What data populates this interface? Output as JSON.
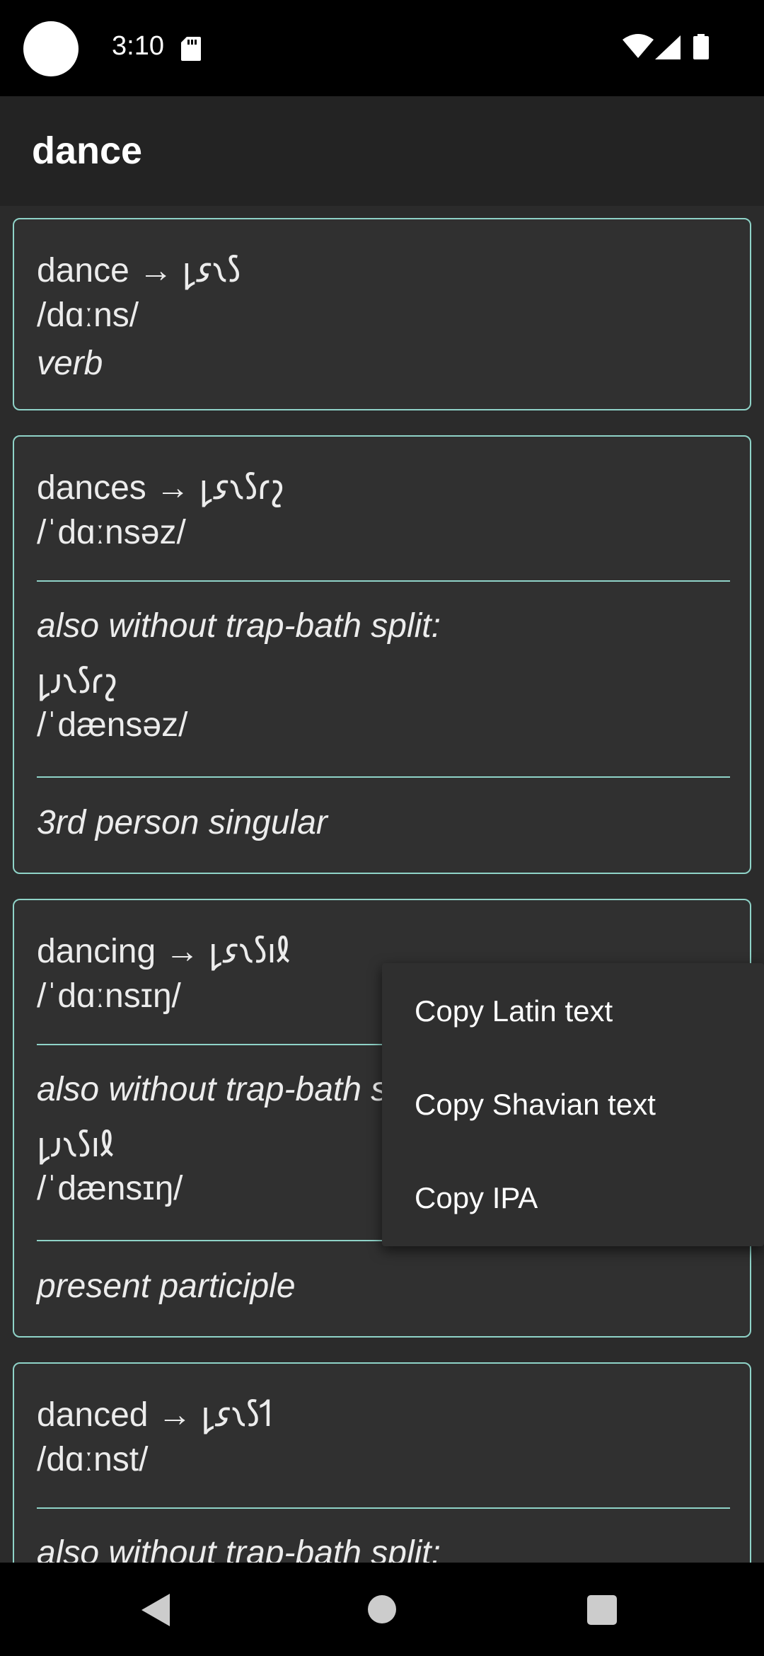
{
  "status": {
    "time": "3:10"
  },
  "app_bar": {
    "title": "dance"
  },
  "cards": [
    {
      "headword": "dance → 𐑛𐑭𐑯𐑕",
      "ipa": "/dɑːns/",
      "pos": "verb"
    },
    {
      "headword": "dances → 𐑛𐑭𐑯𐑕𐑩𐑟",
      "ipa": "/ˈdɑːnsəz/",
      "alt_label": "also without trap-bath split:",
      "alt_shavian": "𐑛𐑨𐑯𐑕𐑩𐑟",
      "alt_ipa": "/ˈdænsəz/",
      "form": "3rd person singular"
    },
    {
      "headword": "dancing → 𐑛𐑭𐑯𐑕𐑦𐑙",
      "ipa": "/ˈdɑːnsɪŋ/",
      "alt_label": "also without trap-bath split:",
      "alt_shavian": "𐑛𐑨𐑯𐑕𐑦𐑙",
      "alt_ipa": "/ˈdænsɪŋ/",
      "form": "present participle"
    },
    {
      "headword": "danced → 𐑛𐑭𐑯𐑕𐑑",
      "ipa": "/dɑːnst/",
      "alt_label": "also without trap-bath split:"
    }
  ],
  "menu": {
    "items": [
      "Copy Latin text",
      "Copy Shavian text",
      "Copy IPA"
    ]
  },
  "colors": {
    "accent_border": "#8fd3c8",
    "background": "#2b2b2b",
    "card": "#303030"
  }
}
